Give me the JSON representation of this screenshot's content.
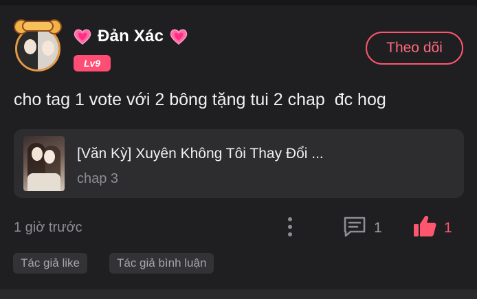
{
  "post": {
    "author": {
      "name": "Đản Xác",
      "level": "Lv9"
    },
    "follow_label": "Theo dõi",
    "comment_text": "cho tag 1 vote với 2 bông tặng tui 2 chap  đc hog",
    "story": {
      "title": "[Văn Kỳ] Xuyên Không Tôi Thay Đổi ...",
      "chapter": "chap 3"
    },
    "timestamp": "1 giờ trước",
    "comment_count": "1",
    "like_count": "1",
    "tags": [
      "Tác giả like",
      "Tác giả bình luận"
    ]
  },
  "icons": {
    "decorations": [
      "heart-icon",
      "heart-icon"
    ],
    "actions": [
      "more-vertical-icon",
      "comment-icon",
      "thumbs-up-icon"
    ]
  },
  "colors": {
    "accent": "#ff5670",
    "level_badge": "#ff4d73",
    "background": "#1f1f21",
    "card": "#2d2d30"
  }
}
